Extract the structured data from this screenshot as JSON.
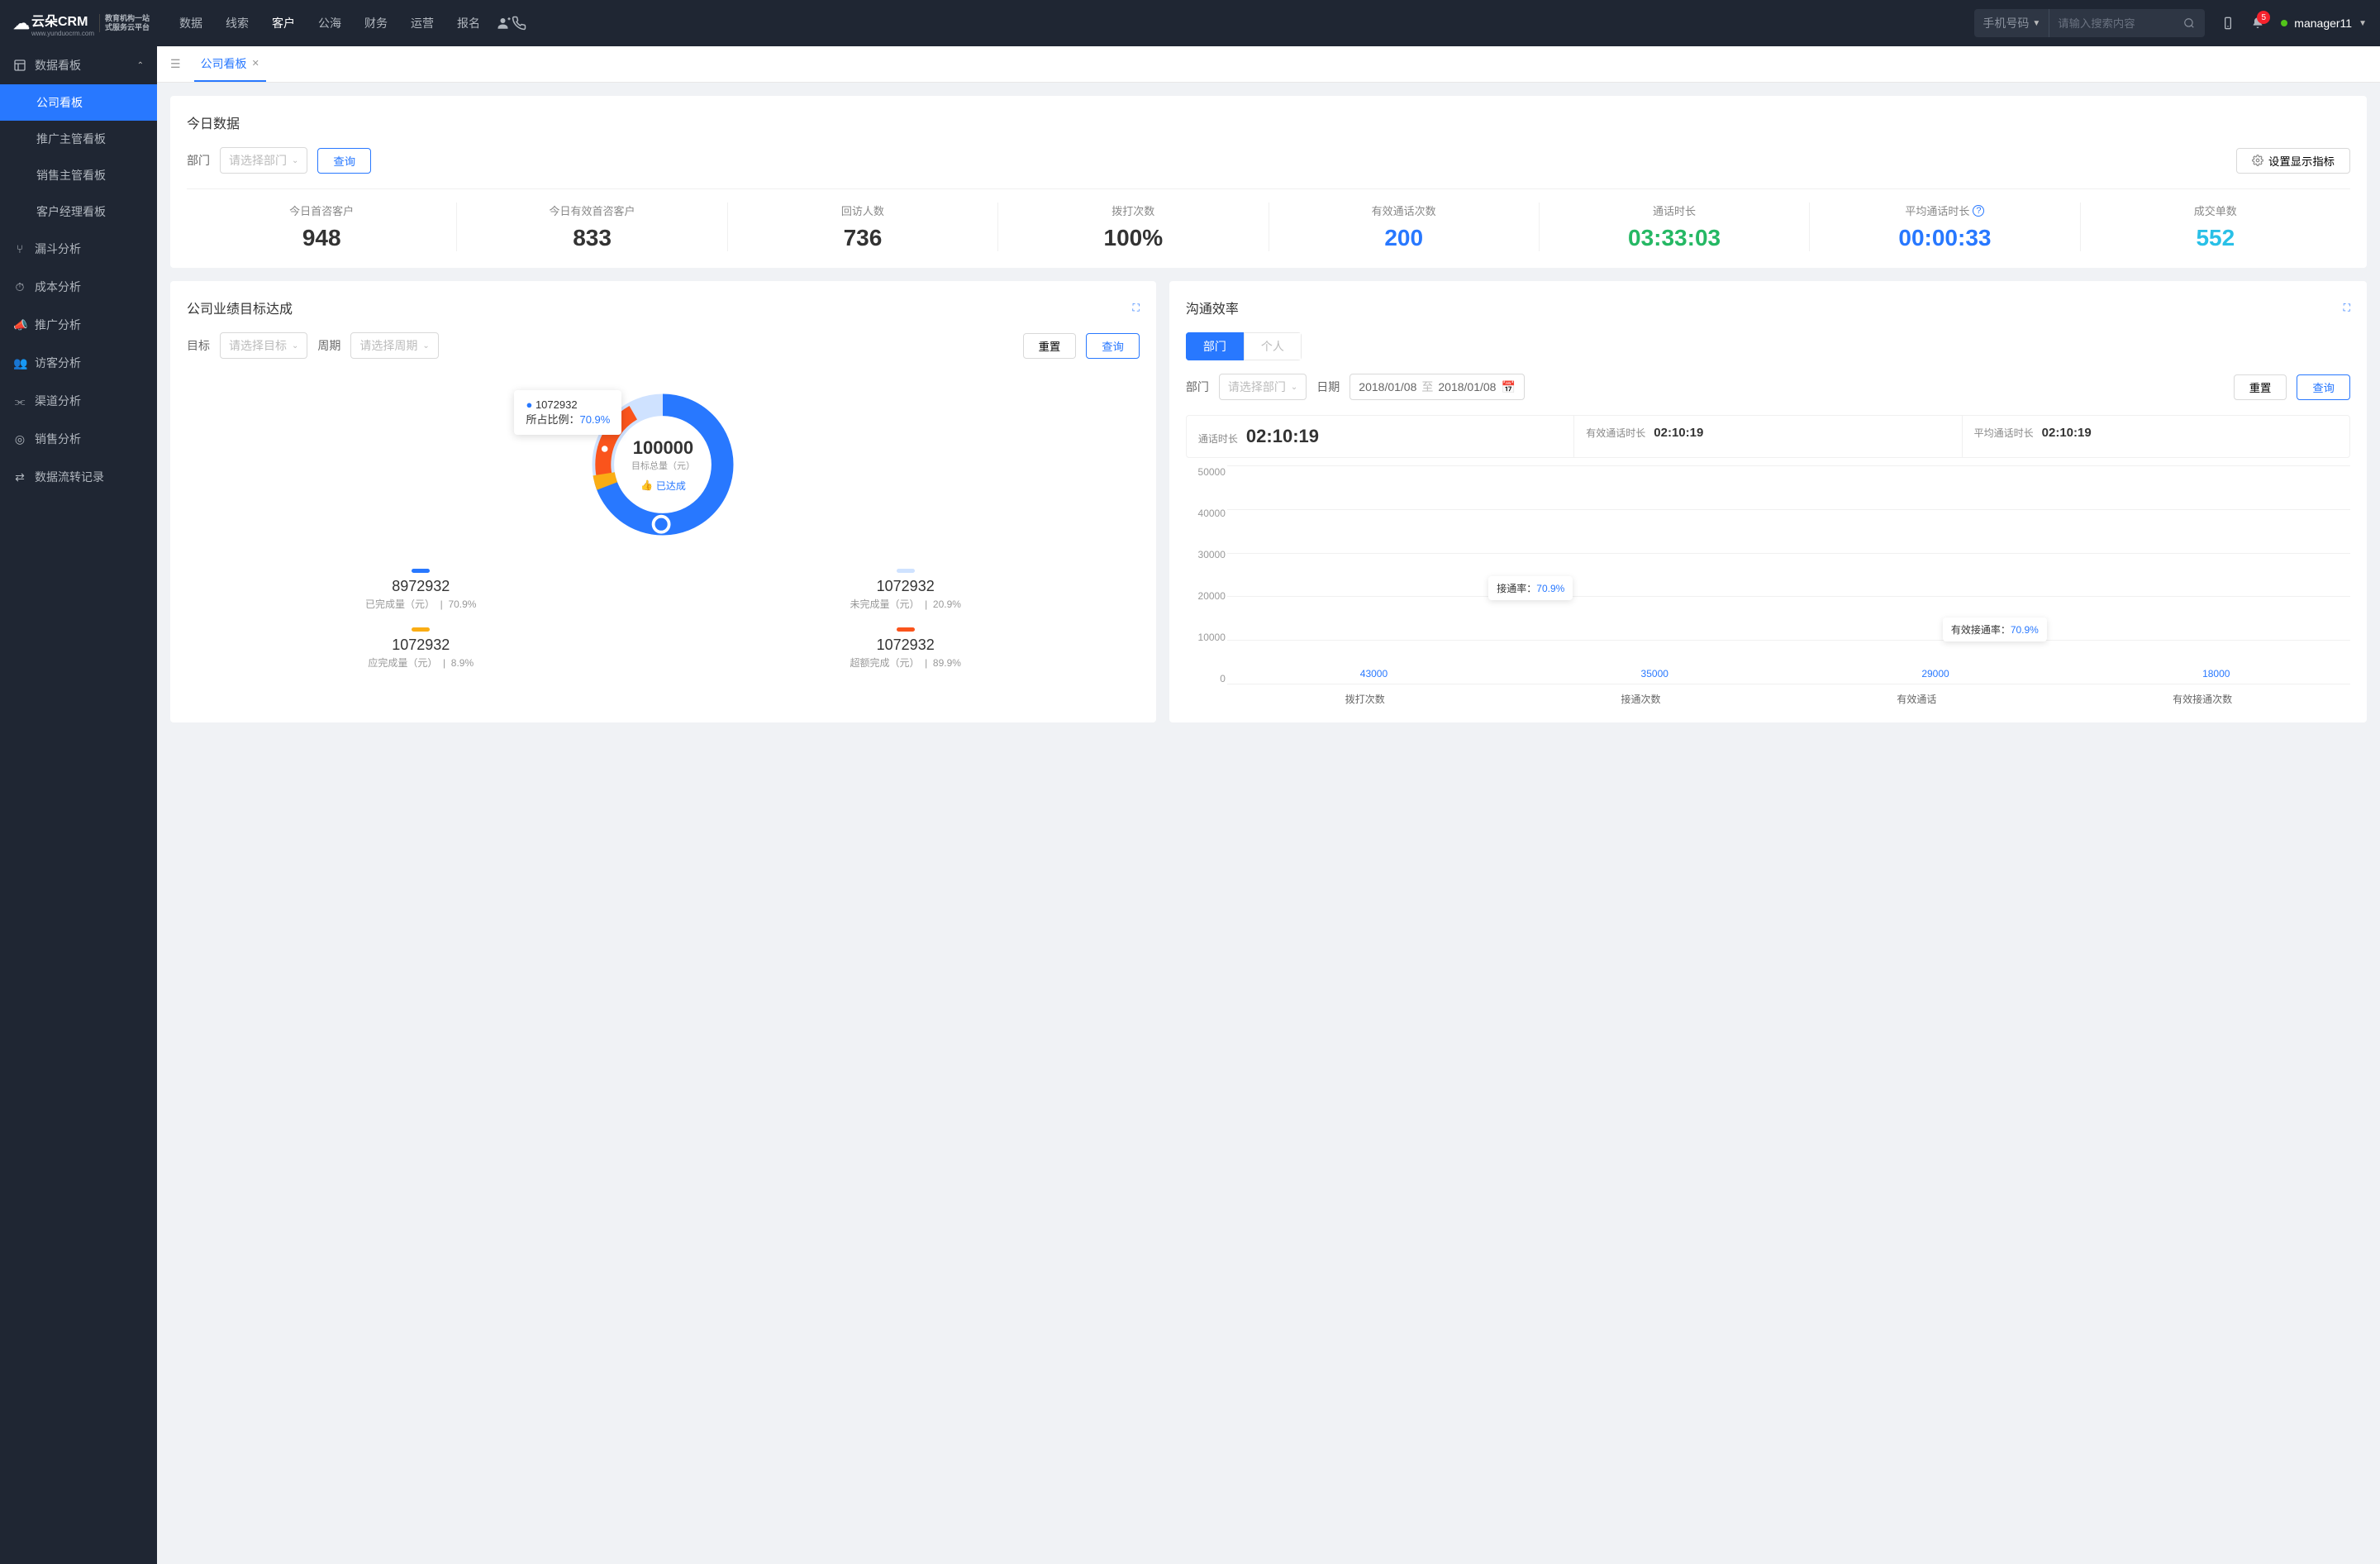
{
  "brand": {
    "main": "云朵CRM",
    "sub1": "教育机构一站",
    "sub2": "式服务云平台",
    "url": "www.yunduocrm.com"
  },
  "nav": [
    "数据",
    "线索",
    "客户",
    "公海",
    "财务",
    "运营",
    "报名"
  ],
  "nav_active": 2,
  "search": {
    "type": "手机号码",
    "placeholder": "请输入搜索内容"
  },
  "notif_count": "5",
  "user": {
    "name": "manager11"
  },
  "sidebar": {
    "group": "数据看板",
    "subs": [
      "公司看板",
      "推广主管看板",
      "销售主管看板",
      "客户经理看板"
    ],
    "sub_active": 0,
    "items": [
      "漏斗分析",
      "成本分析",
      "推广分析",
      "访客分析",
      "渠道分析",
      "销售分析",
      "数据流转记录"
    ]
  },
  "tab": {
    "label": "公司看板"
  },
  "today": {
    "title": "今日数据",
    "dept_label": "部门",
    "dept_placeholder": "请选择部门",
    "query": "查询",
    "settings_btn": "设置显示指标",
    "stats": [
      {
        "label": "今日首咨客户",
        "value": "948",
        "color": "#333"
      },
      {
        "label": "今日有效首咨客户",
        "value": "833",
        "color": "#333"
      },
      {
        "label": "回访人数",
        "value": "736",
        "color": "#333"
      },
      {
        "label": "拨打次数",
        "value": "100%",
        "color": "#333"
      },
      {
        "label": "有效通话次数",
        "value": "200",
        "color": "#2878ff"
      },
      {
        "label": "通话时长",
        "value": "03:33:03",
        "color": "#25b864"
      },
      {
        "label": "平均通话时长",
        "value": "00:00:33",
        "color": "#2878ff",
        "info": true
      },
      {
        "label": "成交单数",
        "value": "552",
        "color": "#29c0e7"
      }
    ]
  },
  "goal": {
    "title": "公司业绩目标达成",
    "target_label": "目标",
    "target_placeholder": "请选择目标",
    "period_label": "周期",
    "period_placeholder": "请选择周期",
    "reset": "重置",
    "query": "查询",
    "center_value": "100000",
    "center_sub": "目标总量（元）",
    "achieved": "已达成",
    "tooltip": {
      "value": "1072932",
      "ratio_label": "所占比例：",
      "ratio": "70.9%"
    },
    "legend": [
      {
        "color": "#2878ff",
        "value": "8972932",
        "label": "已完成量（元）",
        "pct": "70.9%"
      },
      {
        "color": "#cfe2ff",
        "value": "1072932",
        "label": "未完成量（元）",
        "pct": "20.9%"
      },
      {
        "color": "#faad14",
        "value": "1072932",
        "label": "应完成量（元）",
        "pct": "8.9%"
      },
      {
        "color": "#fa541c",
        "value": "1072932",
        "label": "超额完成（元）",
        "pct": "89.9%"
      }
    ]
  },
  "comm": {
    "title": "沟通效率",
    "seg": [
      "部门",
      "个人"
    ],
    "seg_active": 0,
    "dept_label": "部门",
    "dept_placeholder": "请选择部门",
    "date_label": "日期",
    "date_from": "2018/01/08",
    "date_sep": "至",
    "date_to": "2018/01/08",
    "reset": "重置",
    "query": "查询",
    "times": [
      {
        "label": "通话时长",
        "value": "02:10:19",
        "big": true
      },
      {
        "label": "有效通话时长",
        "value": "02:10:19"
      },
      {
        "label": "平均通话时长",
        "value": "02:10:19"
      }
    ],
    "chips": [
      {
        "label": "接通率：",
        "value": "70.9%",
        "left": "26%",
        "top": "46%"
      },
      {
        "label": "有效接通率：",
        "value": "70.9%",
        "left": "65%",
        "top": "63%"
      }
    ]
  },
  "chart_data": {
    "type": "bar",
    "categories": [
      "拨打次数",
      "接通次数",
      "有效通话",
      "有效接通次数"
    ],
    "values": [
      43000,
      35000,
      29000,
      18000
    ],
    "ylim": [
      0,
      50000
    ],
    "yticks": [
      0,
      10000,
      20000,
      30000,
      40000,
      50000
    ],
    "last_bar_light": true
  }
}
